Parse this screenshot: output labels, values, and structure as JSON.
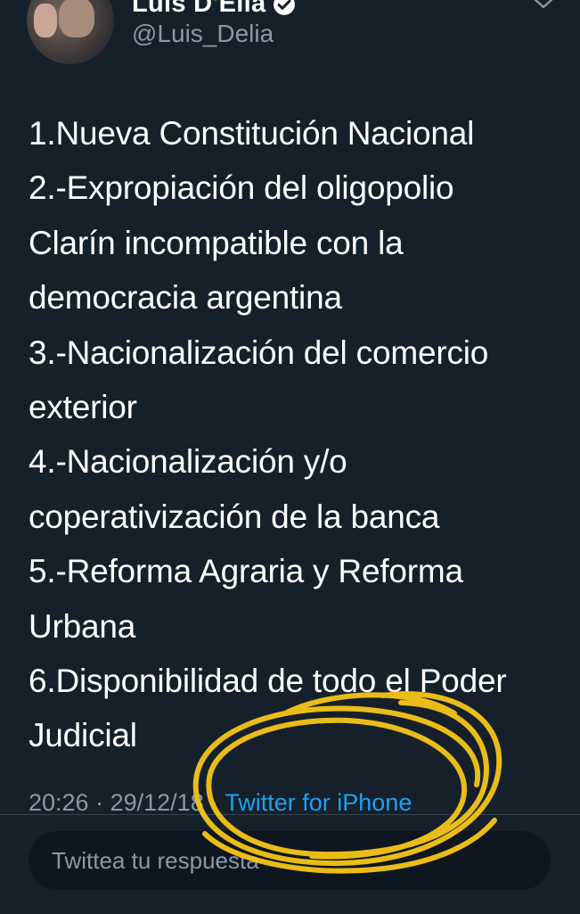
{
  "author": {
    "name": "Luis D'Elia",
    "handle": "@Luis_Delia",
    "verified_icon": "verified-badge-icon",
    "avatar": "avatar-photo"
  },
  "tweet": {
    "lines": [
      "1.Nueva Constitución Nacional",
      "2.-Expropiación del oligopolio",
      "Clarín incompatible con la",
      "democracia argentina",
      "3.-Nacionalización del comercio",
      "exterior",
      "4.-Nacionalización y/o",
      "coperativización de la banca",
      "5.-Reforma Agraria y Reforma",
      "Urbana",
      "6.Disponibilidad de todo el Poder",
      "Judicial"
    ],
    "time": "20:26",
    "separator": "·",
    "date": "29/12/18",
    "source": "Twitter for iPhone"
  },
  "reply": {
    "placeholder": "Twittea tu respuesta"
  },
  "colors": {
    "background": "#15202b",
    "text": "#ffffff",
    "secondary": "#8899a6",
    "link": "#1da1f2",
    "annotation": "#f5c518"
  }
}
